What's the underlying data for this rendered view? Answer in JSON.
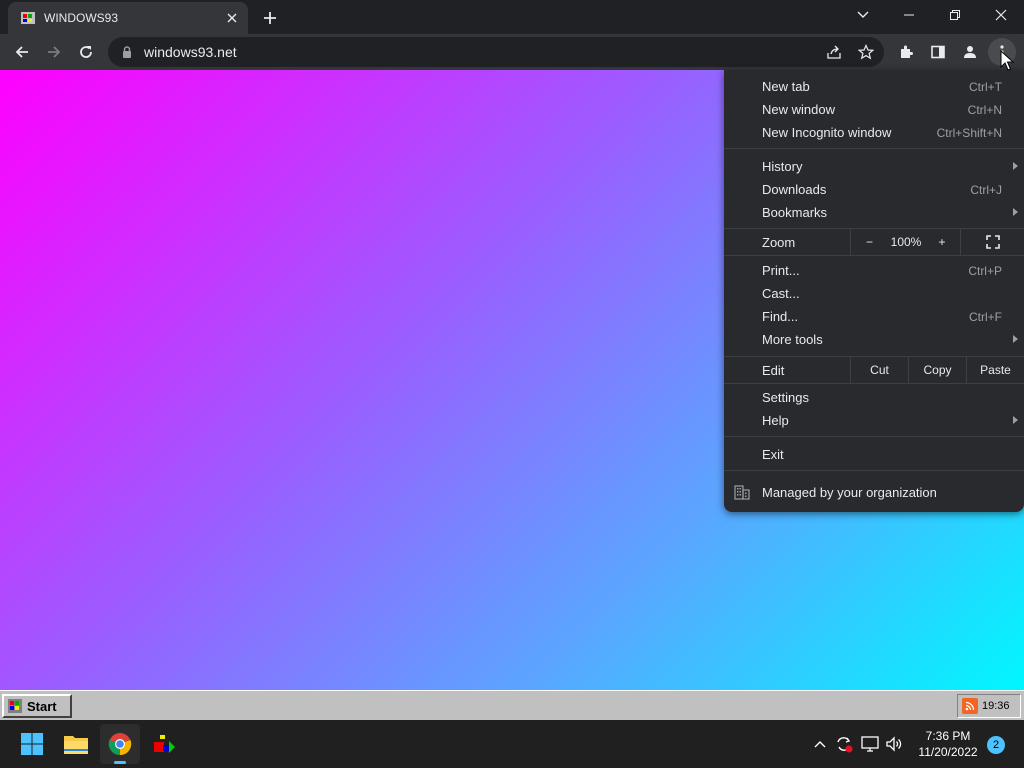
{
  "browser": {
    "tab_title": "WINDOWS93",
    "url": "windows93.net"
  },
  "menu": {
    "group1": [
      {
        "label": "New tab",
        "accel": "Ctrl+T"
      },
      {
        "label": "New window",
        "accel": "Ctrl+N"
      },
      {
        "label": "New Incognito window",
        "accel": "Ctrl+Shift+N"
      }
    ],
    "group2": [
      {
        "label": "History",
        "accel": ""
      },
      {
        "label": "Downloads",
        "accel": "Ctrl+J"
      },
      {
        "label": "Bookmarks",
        "accel": ""
      }
    ],
    "zoom": {
      "label": "Zoom",
      "minus": "−",
      "value": "100%",
      "plus": "+"
    },
    "group3": [
      {
        "label": "Print...",
        "accel": "Ctrl+P"
      },
      {
        "label": "Cast...",
        "accel": ""
      },
      {
        "label": "Find...",
        "accel": "Ctrl+F"
      },
      {
        "label": "More tools",
        "accel": ""
      }
    ],
    "edit": {
      "label": "Edit",
      "cut": "Cut",
      "copy": "Copy",
      "paste": "Paste"
    },
    "group4": [
      {
        "label": "Settings",
        "accel": ""
      },
      {
        "label": "Help",
        "accel": ""
      }
    ],
    "exit": "Exit",
    "managed": "Managed by your organization"
  },
  "win93": {
    "start_label": "Start",
    "tray_time": "19:36"
  },
  "taskbar": {
    "time": "7:36 PM",
    "date": "11/20/2022",
    "notifications": "2"
  },
  "colors": {
    "chrome_dark": "#202124",
    "toolbar": "#35363a",
    "menu_bg": "#292a2d",
    "accent": "#4cc2ff"
  }
}
